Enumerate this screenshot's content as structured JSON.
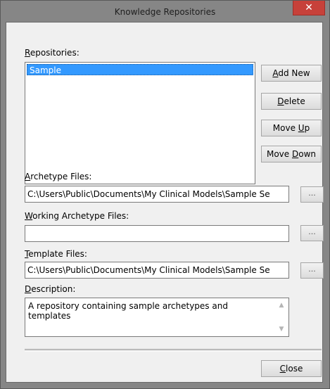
{
  "window": {
    "title": "Knowledge Repositories",
    "close_glyph": "✕"
  },
  "repositories": {
    "label_underlined": "R",
    "label_rest": "epositories:",
    "items": [
      {
        "label": "Sample",
        "selected": true
      }
    ]
  },
  "buttons": {
    "add_new": {
      "pre": "",
      "ul": "A",
      "post": "dd New"
    },
    "delete": {
      "pre": "",
      "ul": "D",
      "post": "elete"
    },
    "move_up": {
      "pre": "Move ",
      "ul": "U",
      "post": "p"
    },
    "move_down": {
      "pre": "Move ",
      "ul": "D",
      "post": "own"
    },
    "close": {
      "pre": "",
      "ul": "C",
      "post": "lose"
    }
  },
  "archetype_files": {
    "label_ul": "A",
    "label_rest": "rchetype Files:",
    "value": "C:\\Users\\Public\\Documents\\My Clinical Models\\Sample Se",
    "browse_label": "..."
  },
  "working_archetype_files": {
    "label_ul": "W",
    "label_rest": "orking Archetype Files:",
    "value": "",
    "browse_label": "..."
  },
  "template_files": {
    "label_ul": "T",
    "label_rest": "emplate Files:",
    "value": "C:\\Users\\Public\\Documents\\My Clinical Models\\Sample Se",
    "browse_label": "..."
  },
  "description": {
    "label_ul": "D",
    "label_rest": "escription:",
    "value": "A repository containing sample archetypes and templates",
    "scroll_up_glyph": "▲",
    "scroll_down_glyph": "▼"
  },
  "colors": {
    "selection": "#3399ff",
    "close_button": "#c7413a",
    "frame": "#868686",
    "client": "#f0f0f0"
  }
}
